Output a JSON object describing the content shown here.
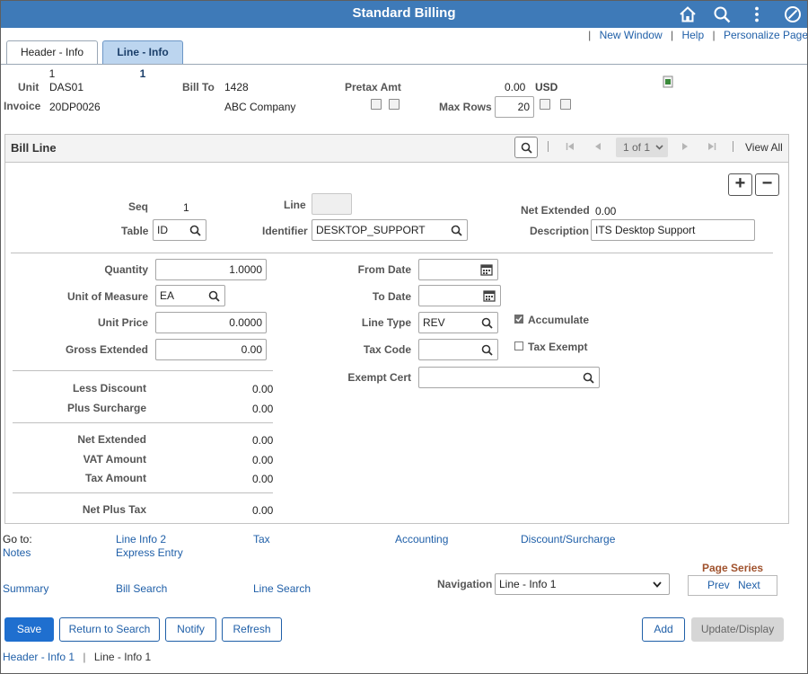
{
  "app": {
    "title": "Standard Billing"
  },
  "toplinks": {
    "new_window": "New Window",
    "help": "Help",
    "personalize": "Personalize Page"
  },
  "tabs": [
    {
      "label": "Header - Info 1"
    },
    {
      "label": "Line - Info 1"
    }
  ],
  "header": {
    "unit_label": "Unit",
    "unit_value": "DAS01",
    "invoice_label": "Invoice",
    "invoice_value": "20DP0026",
    "billto_label": "Bill To",
    "billto_value": "1428",
    "billto_name": "ABC Company",
    "pretax_label": "Pretax Amt",
    "pretax_value": "0.00",
    "pretax_currency": "USD",
    "maxrows_label": "Max Rows",
    "maxrows_value": "20"
  },
  "grid": {
    "title": "Bill Line",
    "pager": "1 of 1",
    "view_all": "View All"
  },
  "line": {
    "seq_label": "Seq",
    "seq_value": "1",
    "line_label": "Line",
    "net_ext_top_label": "Net Extended",
    "net_ext_top_value": "0.00",
    "table_label": "Table",
    "table_value": "ID",
    "identifier_label": "Identifier",
    "identifier_value": "DESKTOP_SUPPORT",
    "description_label": "Description",
    "description_value": "ITS Desktop Support",
    "quantity_label": "Quantity",
    "quantity_value": "1.0000",
    "uom_label": "Unit of Measure",
    "uom_value": "EA",
    "unit_price_label": "Unit Price",
    "unit_price_value": "0.0000",
    "gross_ext_label": "Gross Extended",
    "gross_ext_value": "0.00",
    "less_discount_label": "Less Discount",
    "less_discount_value": "0.00",
    "plus_surcharge_label": "Plus Surcharge",
    "plus_surcharge_value": "0.00",
    "net_ext_label": "Net Extended",
    "net_ext_value": "0.00",
    "vat_label": "VAT Amount",
    "vat_value": "0.00",
    "tax_amount_label": "Tax Amount",
    "tax_amount_value": "0.00",
    "net_plus_tax_label": "Net Plus Tax",
    "net_plus_tax_value": "0.00",
    "from_date_label": "From Date",
    "from_date_value": "",
    "to_date_label": "To Date",
    "to_date_value": "",
    "line_type_label": "Line Type",
    "line_type_value": "REV",
    "tax_code_label": "Tax Code",
    "tax_code_value": "",
    "exempt_cert_label": "Exempt Cert",
    "exempt_cert_value": "",
    "accumulate_label": "Accumulate",
    "accumulate_checked": true,
    "tax_exempt_label": "Tax Exempt",
    "tax_exempt_checked": false
  },
  "goto": {
    "label": "Go to:",
    "links": {
      "line_info_2": "Line Info 2",
      "tax": "Tax",
      "accounting": "Accounting",
      "discount_surcharge": "Discount/Surcharge",
      "notes": "Notes",
      "express_entry": "Express Entry",
      "summary": "Summary",
      "bill_search": "Bill Search",
      "line_search": "Line Search"
    }
  },
  "navigation": {
    "label": "Navigation",
    "selected": "Line - Info 1"
  },
  "page_series": {
    "title": "Page Series",
    "prev": "Prev",
    "next": "Next"
  },
  "buttons": {
    "save": "Save",
    "return_to_search": "Return to Search",
    "notify": "Notify",
    "refresh": "Refresh",
    "add": "Add",
    "update_display": "Update/Display"
  },
  "breadcrumb": {
    "first": "Header - Info 1",
    "sep": "|",
    "second": "Line - Info 1"
  },
  "colors": {
    "topbar": "#3e7ab8",
    "link": "#1f5fa8",
    "primary": "#1f6fcf",
    "tab_active": "#bcd5ef"
  }
}
